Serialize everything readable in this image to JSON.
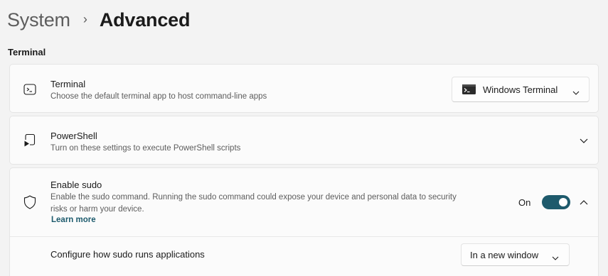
{
  "breadcrumb": {
    "parent": "System",
    "separator": "›",
    "current": "Advanced"
  },
  "section": {
    "title": "Terminal"
  },
  "terminal": {
    "title": "Terminal",
    "description": "Choose the default terminal app to host command-line apps",
    "selected": "Windows Terminal",
    "icon": "terminal-icon"
  },
  "powershell": {
    "title": "PowerShell",
    "description": "Turn on these settings to execute PowerShell scripts",
    "icon": "powershell-icon"
  },
  "sudo": {
    "title": "Enable sudo",
    "description_line1": "Enable the sudo command. Running the sudo command could expose your device and personal data to security",
    "description_line2": "risks or harm your device.",
    "link": "Learn more",
    "toggle_label": "On",
    "toggle_on": true,
    "icon": "shield-icon",
    "sub_setting": {
      "label": "Configure how sudo runs applications",
      "selected": "In a new window"
    }
  },
  "colors": {
    "accent": "#1e5a6c",
    "link": "#1d5b6d",
    "background": "#f3f3f3",
    "card": "#fbfbfb"
  }
}
